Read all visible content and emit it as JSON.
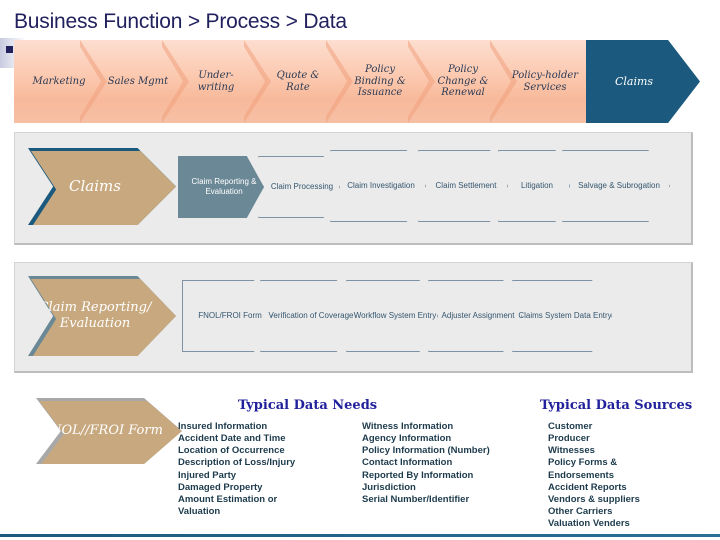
{
  "slide": {
    "title": "Business Function > Process > Data",
    "accent_navy": "#21215e",
    "accent_teal": "#1b5a7e",
    "accent_slate": "#6b8896",
    "accent_gray": "#a8a8a8",
    "peach": "#fbc8ae"
  },
  "value_chain": {
    "steps": [
      {
        "label": "Marketing"
      },
      {
        "label": "Sales Mgmt"
      },
      {
        "label": "Under-writing"
      },
      {
        "label": "Quote & Rate"
      },
      {
        "label": "Policy Binding & Issuance"
      },
      {
        "label": "Policy Change & Renewal"
      },
      {
        "label": "Policy-holder Services"
      }
    ],
    "highlight": "Claims"
  },
  "claims_process": {
    "parent": "Claims",
    "steps": [
      {
        "label": "Claim Reporting & Evaluation",
        "selected": true
      },
      {
        "label": "Claim Processing",
        "selected": false
      },
      {
        "label": "Claim Investigation",
        "selected": false
      },
      {
        "label": "Claim Settlement",
        "selected": false
      },
      {
        "label": "Litigation",
        "selected": false
      },
      {
        "label": "Salvage & Subrogation",
        "selected": false
      }
    ]
  },
  "reporting_process": {
    "parent": "Claim Reporting/ Evaluation",
    "steps": [
      {
        "label": "FNOL/FROI Form",
        "selected": false
      },
      {
        "label": "Verification of Coverage",
        "selected": false
      },
      {
        "label": "Workflow System Entry",
        "selected": false
      },
      {
        "label": "Adjuster Assignment",
        "selected": false
      },
      {
        "label": "Claims System Data Entry",
        "selected": false
      }
    ]
  },
  "data_detail": {
    "subject": "FNOL//FROI Form",
    "needs_heading": "Typical Data Needs",
    "needs_column_1": [
      "Insured Information",
      "Accident Date and Time",
      "Location of Occurrence",
      "Description of Loss/Injury",
      "Injured Party",
      "Damaged Property",
      "Amount Estimation or",
      "Valuation"
    ],
    "needs_column_2": [
      "Witness Information",
      "Agency Information",
      "Policy Information (Number)",
      "Contact Information",
      "Reported By Information",
      "Jurisdiction",
      "Serial Number/Identifier"
    ],
    "sources_heading": "Typical Data Sources",
    "sources": [
      "Customer",
      "Producer",
      "Witnesses",
      "Policy Forms &",
      "Endorsements",
      "Accident Reports",
      "Vendors & suppliers",
      "Other Carriers",
      "Valuation Venders"
    ]
  }
}
